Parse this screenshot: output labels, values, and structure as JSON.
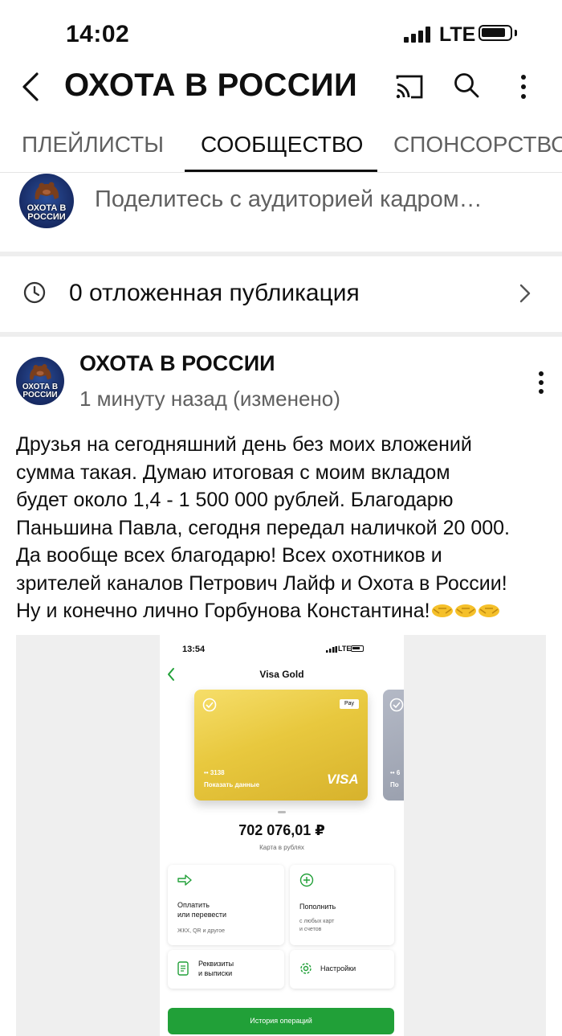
{
  "status_bar": {
    "time": "14:02",
    "network": "LTE"
  },
  "header": {
    "title": "ОХОТА В РОССИИ"
  },
  "tabs": [
    {
      "label": "ПЛЕЙЛИСТЫ"
    },
    {
      "label": "СООБЩЕСТВО",
      "selected": true
    },
    {
      "label": "СПОНСОРСТВО"
    }
  ],
  "compose": {
    "placeholder": "Поделитесь с аудиторией кадром…",
    "avatar_text": "ОХОТА В РОССИИ"
  },
  "scheduled": {
    "label": "0 отложенная публикация"
  },
  "post": {
    "author": "ОХОТА В РОССИИ",
    "time": "1 минуту назад (изменено)",
    "lines": [
      "Друзья на сегодняшний день без моих вложений",
      "сумма такая. Думаю итоговая с моим вкладом",
      "будет около 1,4 - 1 500 000 рублей. Благодарю",
      "Паньшина Павла, сегодня передал наличкой 20 000.",
      "Да вообще всех благодарю! Всех охотников и",
      "зрителей каналов Петрович Лайф и Охота в России!",
      "Ну и конечно лично Горбунова Константина!"
    ],
    "image": {
      "status_time": "13:54",
      "status_network": "LTE",
      "screen_title": "Visa Gold",
      "card": {
        "pay_badge": "Pay",
        "number": "•• 3138",
        "show_label": "Показать данные",
        "brand": "VISA"
      },
      "card2": {
        "number": "•• 6",
        "show_label": "По"
      },
      "balance": "702 076,01 ₽",
      "balance_caption": "Карта в рублях",
      "tiles": {
        "pay": {
          "title_1": "Оплатить",
          "title_2": "или перевести",
          "sub": "ЖКХ, QR и другое"
        },
        "topup": {
          "title": "Пополнить",
          "sub_1": "с любых карт",
          "sub_2": "и счетов"
        },
        "requisites": {
          "title_1": "Реквизиты",
          "title_2": "и выписки"
        },
        "settings": {
          "title": "Настройки"
        }
      },
      "history_button": "История операций",
      "accent_color": "#21a038"
    }
  }
}
